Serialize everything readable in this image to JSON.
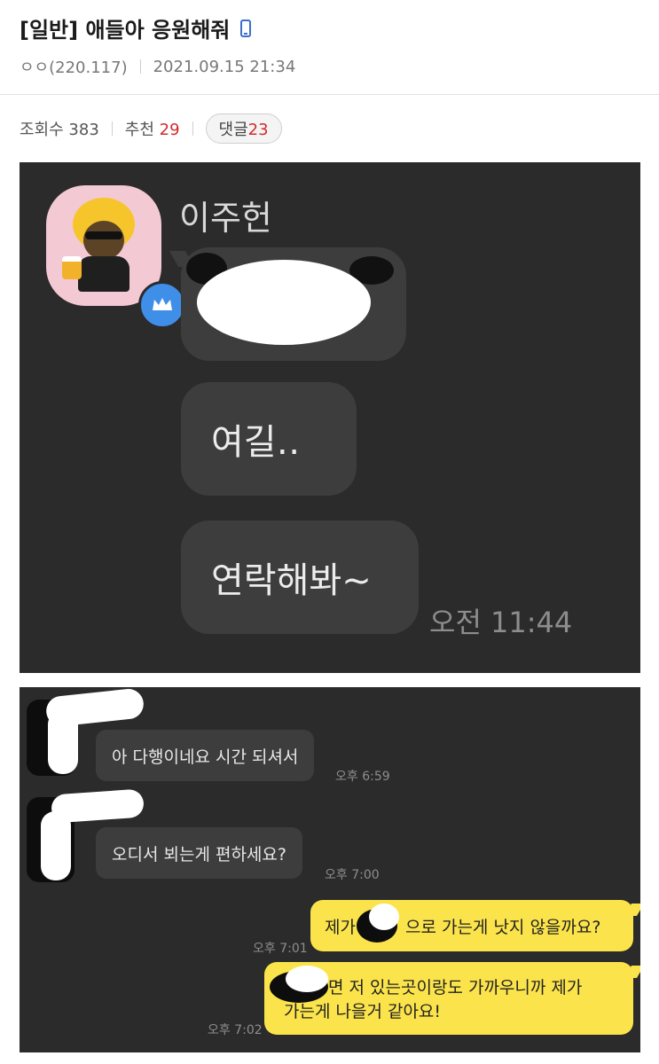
{
  "post": {
    "title": "[일반] 애들아 응원해줘",
    "author": "ㅇㅇ(220.117)",
    "date": "2021.09.15 21:34",
    "views_label": "조회수",
    "views": "383",
    "recommend_label": "추천",
    "recommend": "29",
    "comments_label": "댓글",
    "comments": "23",
    "accent_color": "#d22b2b",
    "device_icon": "mobile-phone-icon"
  },
  "chat1": {
    "sender": "이주헌",
    "messages": [
      "여길‥",
      "연락해봐~"
    ],
    "time": "오전 11:44",
    "badge_icon": "crown-icon"
  },
  "chat2": {
    "received": [
      {
        "text": "아 다행이네요 시간 되셔서",
        "time": "오후 6:59"
      },
      {
        "text": "오디서 뵈는게 편하세요?",
        "time": "오후 7:00"
      }
    ],
    "sent": [
      {
        "pre": "제가",
        "post": "으로 가는게 낫지 않을까요?",
        "time": "오후 7:01"
      },
      {
        "line1": "면 저 있는곳이랑도 가까우니까 제가",
        "line2": "가는게 나을거 같아요!",
        "time": "오후 7:02"
      }
    ],
    "sent_color": "#fbe44b"
  }
}
